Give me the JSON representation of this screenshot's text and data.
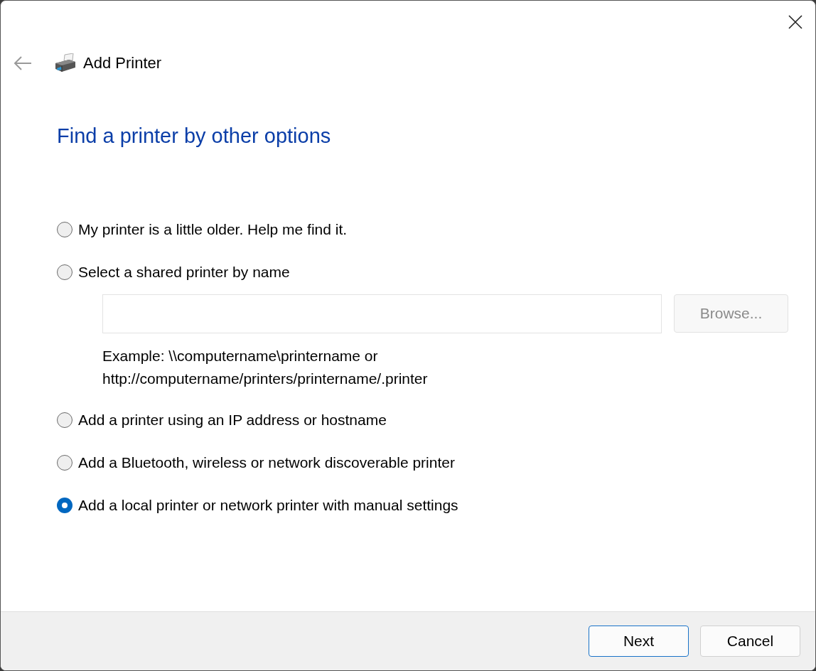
{
  "window": {
    "title": "Add Printer"
  },
  "heading": "Find a printer by other options",
  "options": [
    {
      "kind": "plain",
      "label": "My printer is a little older. Help me find it.",
      "selected": false
    },
    {
      "kind": "with-field",
      "label": "Select a shared printer by name",
      "selected": false,
      "browse": {
        "label": "Browse...",
        "disabled": true
      },
      "example": [
        "Example: \\\\computername\\printername or",
        "http://computername/printers/printername/.printer"
      ]
    },
    {
      "kind": "plain",
      "label": "Add a printer using an IP address or hostname",
      "selected": false
    },
    {
      "kind": "plain",
      "label": "Add a Bluetooth, wireless or network discoverable printer",
      "selected": false
    },
    {
      "kind": "plain",
      "label": "Add a local printer or network printer with manual settings",
      "selected": true
    }
  ],
  "buttons": [
    {
      "label": "Next",
      "default": true
    },
    {
      "label": "Cancel",
      "default": false
    }
  ]
}
